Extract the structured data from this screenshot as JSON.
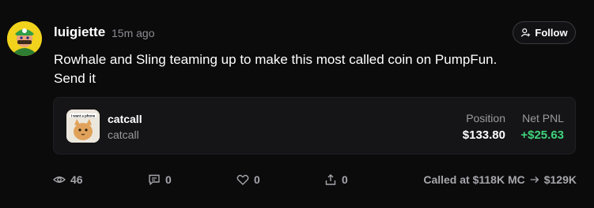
{
  "post": {
    "username": "luigiette",
    "time_ago": "15m ago",
    "follow_label": "Follow",
    "text_line1": "Rowhale and Sling teaming up to make this most called coin on PumpFun.",
    "text_line2": "Send it"
  },
  "coin": {
    "name": "catcall",
    "ticker": "catcall",
    "image_caption": "I want a phone",
    "position_label": "Position",
    "position_value": "$133.80",
    "pnl_label": "Net PNL",
    "pnl_value": "+$25.63",
    "pnl_color": "#3fd47b"
  },
  "stats": {
    "views": "46",
    "comments": "0",
    "likes": "0",
    "shares": "0"
  },
  "called": {
    "prefix": "Called at $118K MC",
    "current": "$129K"
  },
  "icons": {
    "follow": "user-plus-icon",
    "views": "eye-icon",
    "comments": "message-icon",
    "likes": "heart-icon",
    "shares": "share-icon",
    "arrow": "arrow-right-icon"
  }
}
